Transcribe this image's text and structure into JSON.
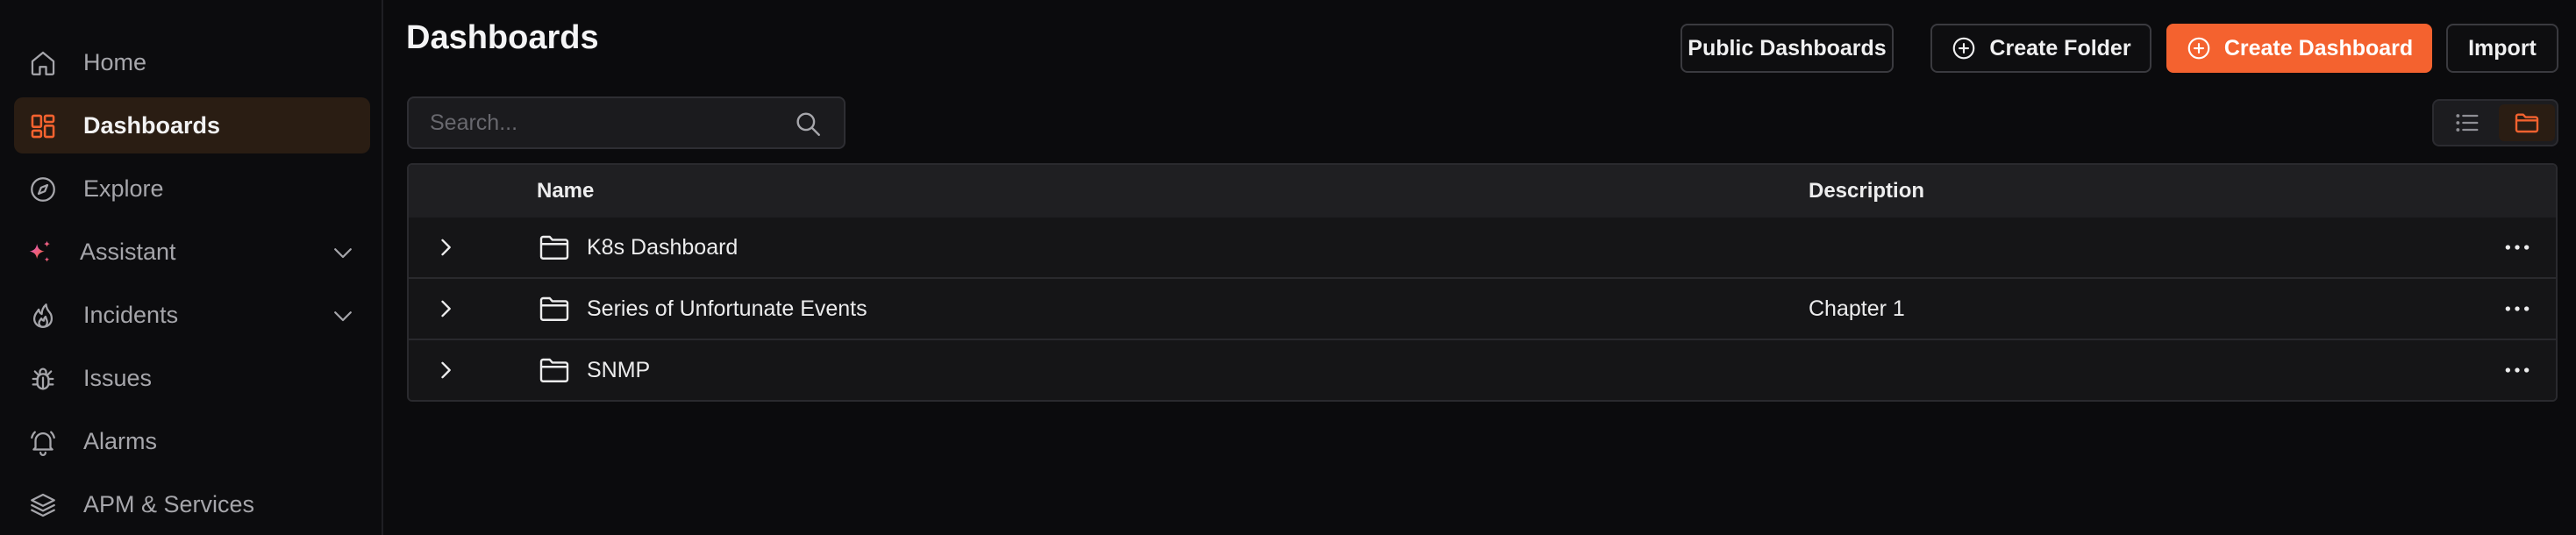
{
  "sidebar": {
    "items": [
      {
        "label": "Home",
        "icon": "home-icon"
      },
      {
        "label": "Dashboards",
        "icon": "dashboards-icon",
        "active": true
      },
      {
        "label": "Explore",
        "icon": "compass-icon"
      },
      {
        "label": "Assistant",
        "icon": "sparkle-icon",
        "expandable": true
      },
      {
        "label": "Incidents",
        "icon": "flame-icon",
        "expandable": true
      },
      {
        "label": "Issues",
        "icon": "bug-icon"
      },
      {
        "label": "Alarms",
        "icon": "bell-icon"
      },
      {
        "label": "APM & Services",
        "icon": "layers-icon"
      }
    ]
  },
  "header": {
    "title": "Dashboards",
    "buttons": {
      "public_dashboards": "Public Dashboards",
      "create_folder": "Create Folder",
      "create_dashboard": "Create Dashboard",
      "import": "Import"
    }
  },
  "search": {
    "placeholder": "Search...",
    "value": ""
  },
  "view_toggle": {
    "options": [
      "list-view-icon",
      "folder-view-icon"
    ],
    "selected": "folder-view-icon"
  },
  "table": {
    "columns": {
      "name": "Name",
      "description": "Description"
    },
    "rows": [
      {
        "name": "K8s Dashboard",
        "description": ""
      },
      {
        "name": "Series of Unfortunate Events",
        "description": "Chapter 1"
      },
      {
        "name": "SNMP",
        "description": ""
      }
    ]
  },
  "colors": {
    "accent": "#f4622f",
    "background": "#0b0b0d",
    "active_bg": "#2a1d13",
    "assistant_gradient": [
      "#e35bd0",
      "#f4622f"
    ]
  }
}
